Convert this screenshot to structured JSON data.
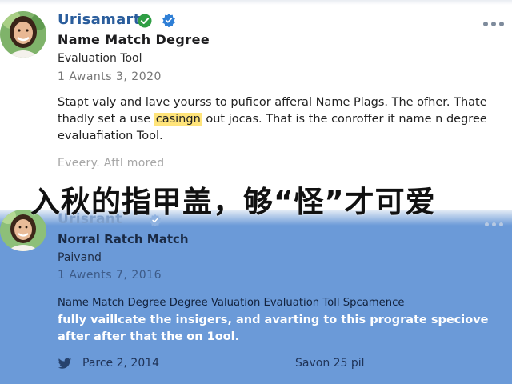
{
  "post_top": {
    "username": "Urisamart",
    "verified_icon": "check-circle-icon",
    "badge_icon": "blue-gear-badge-icon",
    "menu_icon": "more-dots-icon",
    "headline": "Name Match Degree",
    "subtitle": "Evaluation Tool",
    "date": "1 Awants 3, 2020",
    "body_part1": "Stapt valy and lave yourss to puficor afferal Name Plags. The ofher. Thate thadly set a use ",
    "body_highlight": "casingn",
    "body_part2": " out jocas. That is the conroffer it name n degree evaluafiation Tool.",
    "more_text": "Eveery. Aftl mored"
  },
  "caption": "入秋的指甲盖，够“怪”才可爱",
  "post_bottom": {
    "username": "Urisrant",
    "badge_icon": "blue-gear-badge-icon",
    "menu_icon": "more-dots-icon",
    "headline": "Norral Ratch Match",
    "subtitle": "Paivand",
    "date": "1 Awents 7, 2016",
    "body_line1": "Name Match Degree Degree Valuation Evaluation Toll Spcamence",
    "body_line2": "fully vaillcate the insigers, and avarting to this prograte speciove after after that the on 1ool.",
    "footer_icon": "twitter-bird-icon",
    "footer_date": "Parce 2, 2014",
    "footer_right": "Savon 25 pil"
  },
  "colors": {
    "handle_blue": "#2a5d9c",
    "highlight_yellow": "#ffe47a",
    "bottom_card_blue": "#6b9ad8",
    "verified_green": "#2f9e44"
  }
}
